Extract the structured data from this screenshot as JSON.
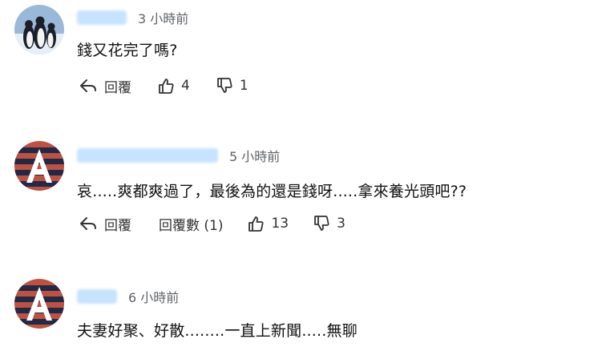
{
  "comments": [
    {
      "time": "3 小時前",
      "text": "錢又花完了嗎?",
      "actions": {
        "reply": "回覆",
        "likes": "4",
        "dislikes": "1"
      }
    },
    {
      "time": "5 小時前",
      "text": "哀.....爽都爽過了，最後為的還是錢呀.....拿來養光頭吧??",
      "actions": {
        "reply": "回覆",
        "replies": "回覆數 (1)",
        "likes": "13",
        "dislikes": "3"
      }
    },
    {
      "time": "6 小時前",
      "text": "夫妻好聚、好散........一直上新聞.....無聊"
    }
  ],
  "colors": {
    "blurred_name": "#c7e3ff",
    "avatar_a_bg": "#c0513e",
    "avatar_a_stripe": "#1e2a48",
    "time": "#5f6368"
  },
  "icons": [
    "penguin-avatar",
    "letter-a-avatar",
    "reply-arrow-icon",
    "thumbs-up-icon",
    "thumbs-down-icon"
  ]
}
